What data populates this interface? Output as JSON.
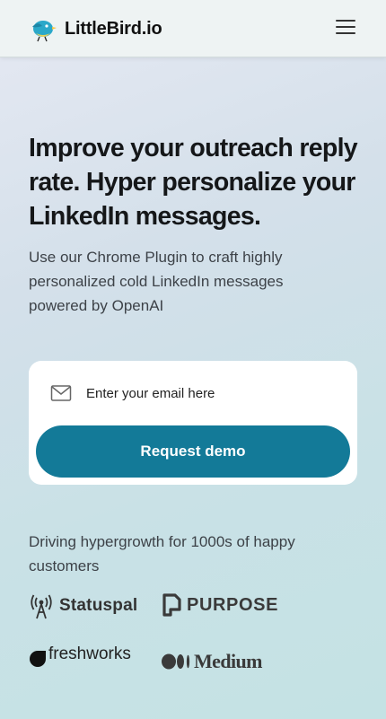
{
  "header": {
    "brand_name": "LittleBird.io",
    "logo_icon": "bird-logo-icon",
    "menu_icon": "hamburger-menu-icon"
  },
  "hero": {
    "title": "Improve your outreach reply rate. Hyper personalize your LinkedIn messages.",
    "subtitle": "Use our Chrome Plugin to craft highly personalized cold LinkedIn messages powered by OpenAI"
  },
  "form": {
    "email_icon": "envelope-icon",
    "email_placeholder": "Enter your email here",
    "email_value": "",
    "submit_label": "Request demo"
  },
  "customers": {
    "heading": "Driving hypergrowth for 1000s of happy customers",
    "logos": [
      {
        "name": "Statuspal",
        "icon": "signal-tower-icon"
      },
      {
        "name": "PURPOSE",
        "icon": "purpose-logo-icon"
      },
      {
        "name": "freshworks",
        "icon": "freshworks-logo-icon"
      },
      {
        "name": "Medium",
        "icon": "medium-logo-icon"
      }
    ]
  },
  "colors": {
    "accent": "#137a98",
    "card": "#ffffff",
    "header_bg": "#eef3f3"
  }
}
